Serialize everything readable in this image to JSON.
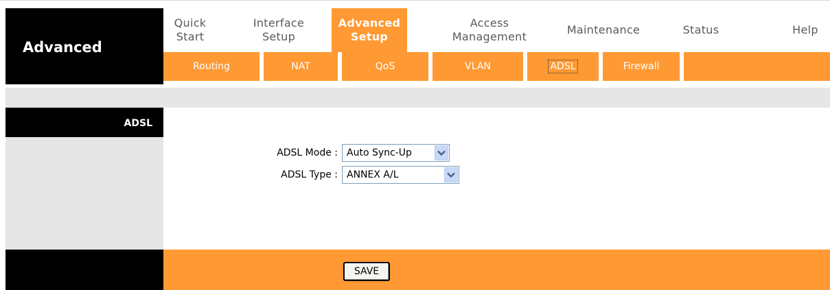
{
  "brand": {
    "label": "Advanced"
  },
  "main_nav": [
    {
      "label": "Quick\nStart",
      "active": false
    },
    {
      "label": "Interface\nSetup",
      "active": false
    },
    {
      "label": "Advanced\nSetup",
      "active": true
    },
    {
      "label": "Access\nManagement",
      "active": false
    },
    {
      "label": "Maintenance",
      "active": false
    },
    {
      "label": "Status",
      "active": false
    },
    {
      "label": "Help",
      "active": false
    }
  ],
  "sub_nav": [
    {
      "label": "Routing",
      "active": false
    },
    {
      "label": "NAT",
      "active": false
    },
    {
      "label": "QoS",
      "active": false
    },
    {
      "label": "VLAN",
      "active": false
    },
    {
      "label": "ADSL",
      "active": true
    },
    {
      "label": "Firewall",
      "active": false
    }
  ],
  "section": {
    "title": "ADSL"
  },
  "form": {
    "adsl_mode": {
      "label": "ADSL Mode :",
      "value": "Auto Sync-Up"
    },
    "adsl_type": {
      "label": "ADSL Type :",
      "value": "ANNEX A/L"
    }
  },
  "footer": {
    "save_label": "SAVE"
  },
  "colors": {
    "accent": "#ff9933",
    "dark": "#000000",
    "band": "#e6e6e6",
    "nav_text": "#595959"
  },
  "icons": {
    "select_arrow": "chevron-down-icon"
  }
}
